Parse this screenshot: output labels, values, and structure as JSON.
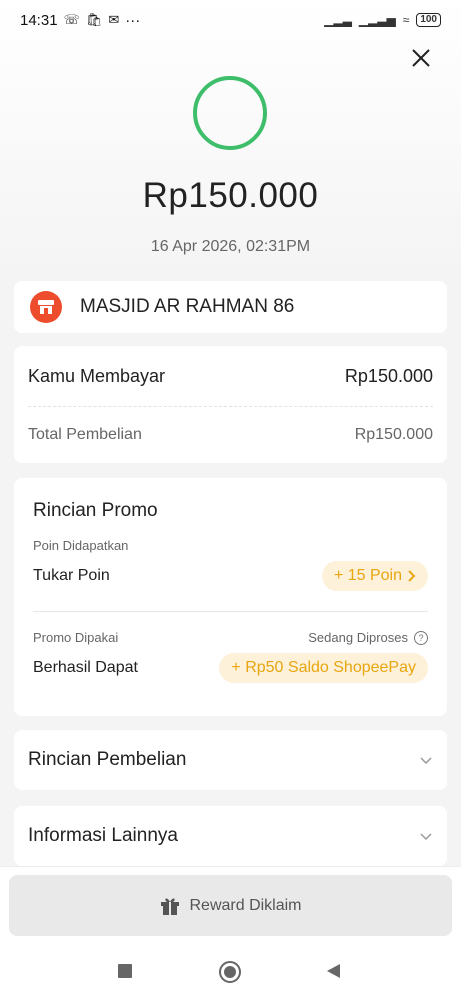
{
  "status_bar": {
    "time": "14:31",
    "notification_icons": [
      "whatsapp-icon",
      "shopping-bag-icon",
      "mail-icon",
      "more-icon"
    ],
    "more": "···",
    "battery": "100"
  },
  "receipt": {
    "amount": "Rp150.000",
    "datetime": "16 Apr 2026, 02:31PM",
    "status_color": "#3ebd6a"
  },
  "merchant": {
    "name": "MASJID AR RAHMAN 86",
    "icon": "shop-icon",
    "icon_color": "#ee4d2d"
  },
  "payment": {
    "paid_label": "Kamu Membayar",
    "paid_value": "Rp150.000",
    "total_label": "Total Pembelian",
    "total_value": "Rp150.000"
  },
  "promo": {
    "title": "Rincian Promo",
    "points_section_label": "Poin Didapatkan",
    "points_row_label": "Tukar Poin",
    "points_pill": "+ 15 Poin",
    "promo_section_label": "Promo Dipakai",
    "promo_status": "Sedang Diproses",
    "promo_row_label": "Berhasil Dapat",
    "promo_pill": "+ Rp50 Saldo ShopeePay",
    "accent_color": "#e8a610"
  },
  "sections": {
    "purchase_details": "Rincian Pembelian",
    "other_info": "Informasi Lainnya"
  },
  "footer": {
    "reward_button": "Reward Diklaim"
  }
}
